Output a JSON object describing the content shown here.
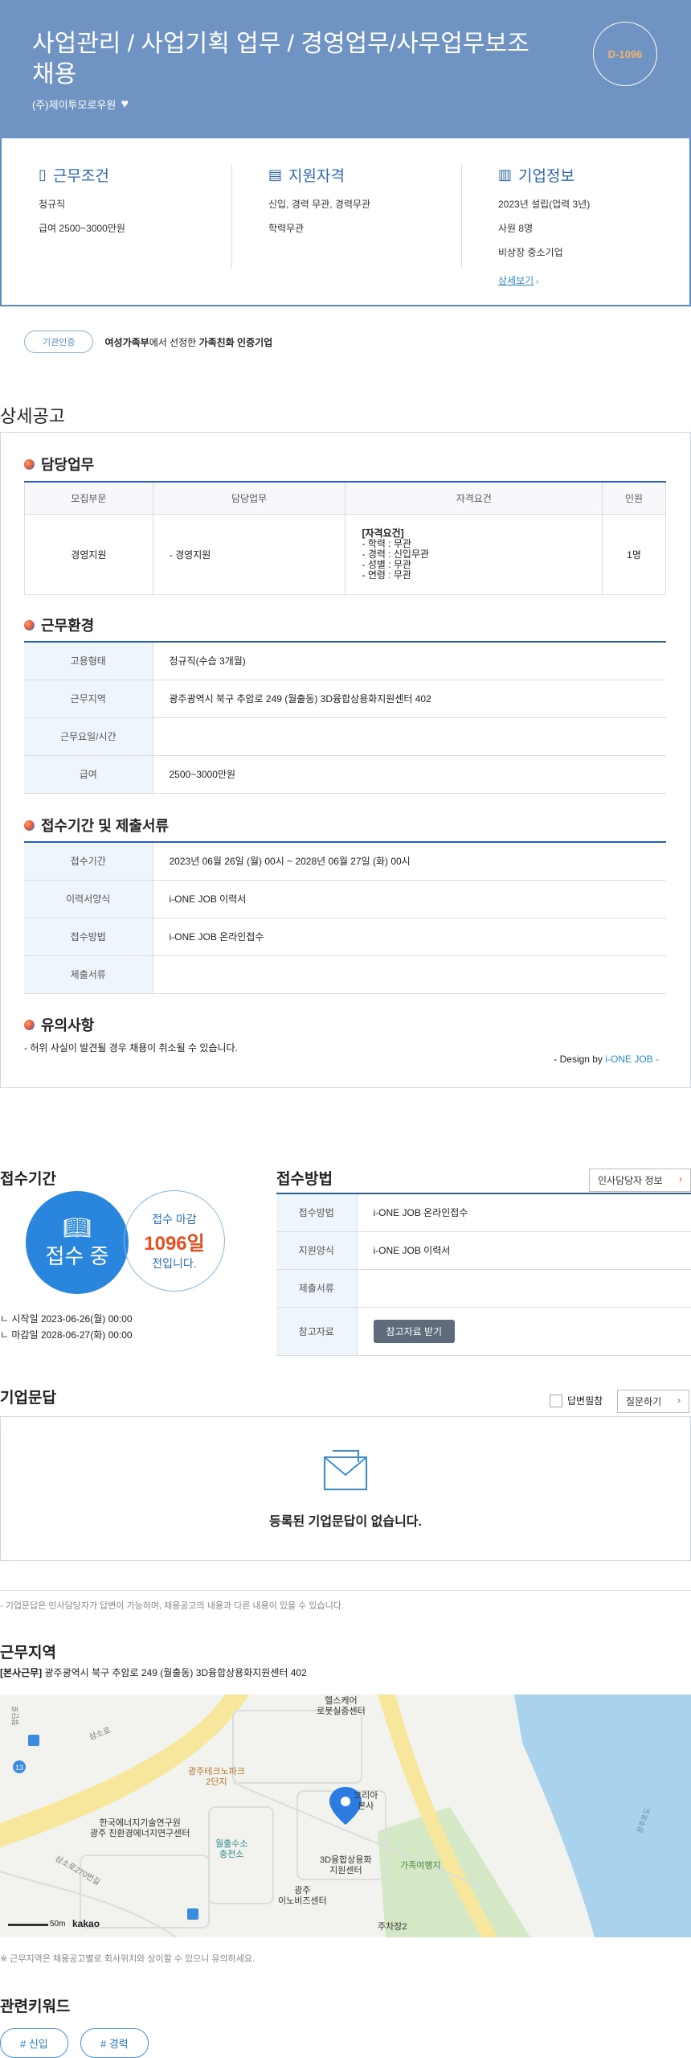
{
  "header": {
    "title": "사업관리 / 사업기획 업무 / 경영업무/사무업무보조 채용",
    "company": "(주)제이투모로우원",
    "dday": "D-1096"
  },
  "summary": {
    "work": {
      "title": "근무조건",
      "lines": [
        "정규직",
        "급여 2500~3000만원"
      ]
    },
    "qual": {
      "title": "지원자격",
      "lines": [
        "신입, 경력 무관, 경력무관",
        "학력무관"
      ]
    },
    "company": {
      "title": "기업정보",
      "lines": [
        "2023년 설립(업력 3년)",
        "사원 8명",
        "비상장 중소기업"
      ],
      "more": "상세보기"
    }
  },
  "cert": {
    "badge": "기관인증",
    "text_a": "여성가족부",
    "text_b": "에서 선정한 ",
    "text_c": "가족친화 인증기업"
  },
  "detail_title": "상세공고",
  "duty": {
    "title": "담당업무",
    "headers": [
      "모집부문",
      "담당업무",
      "자격요건",
      "인원"
    ],
    "row": {
      "dept": "경영지원",
      "task": "- 경영지원",
      "req_title": "[자격요건]",
      "req": [
        "- 학력 : 무관",
        "- 경력 : 신입무관",
        "- 성별 : 무관",
        "- 연령 : 무관"
      ],
      "count": "1명"
    }
  },
  "env": {
    "title": "근무환경",
    "rows": [
      {
        "k": "고용형태",
        "v": "정규직(수습 3개월)"
      },
      {
        "k": "근무지역",
        "v": "광주광역시 북구 추암로 249 (월출동) 3D융합상용화지원센터 402"
      },
      {
        "k": "근무요일/시간",
        "v": ""
      },
      {
        "k": "급여",
        "v": "2500~3000만원"
      }
    ]
  },
  "apply": {
    "title": "접수기간 및 제출서류",
    "rows": [
      {
        "k": "접수기간",
        "v": "2023년 06월 26일 (월) 00시 ~ 2028년 06월 27일 (화) 00시"
      },
      {
        "k": "이력서양식",
        "v": "i-ONE JOB 이력서"
      },
      {
        "k": "접수방법",
        "v": "i-ONE JOB 온라인접수"
      },
      {
        "k": "제출서류",
        "v": ""
      }
    ]
  },
  "caution": {
    "title": "유의사항",
    "text": "- 허위 사실이 발견될 경우 채용이 취소될 수 있습니다.",
    "design": "- Design by ",
    "design_brand": "i-ONE JOB",
    "design_end": " -"
  },
  "period": {
    "title": "접수기간",
    "status": "접수 중",
    "deadline_a": "접수 마감",
    "days": "1096일",
    "deadline_b": "전입니다.",
    "start": "시작일 2023-06-26(월) 00:00",
    "end": "마감일 2028-06-27(화) 00:00"
  },
  "method": {
    "title": "접수방법",
    "contact": "인사담당자 정보",
    "rows": [
      {
        "k": "접수방법",
        "v": "i-ONE JOB 온라인접수"
      },
      {
        "k": "지원양식",
        "v": "i-ONE JOB 이력서"
      },
      {
        "k": "제출서류",
        "v": ""
      },
      {
        "k": "참고자료",
        "v": ""
      }
    ],
    "download": "참고자료 받기"
  },
  "qa": {
    "title": "기업문답",
    "check": "답변필참",
    "ask": "질문하기",
    "empty": "등록된 기업문답이 없습니다.",
    "note": "- 기업문답은 인사담당자가 답변이 가능하며, 채용공고의 내용과 다른 내용이 있을 수 있습니다."
  },
  "location": {
    "title": "근무지역",
    "tag": "[본사근무]",
    "addr": " 광주광역시 북구 추암로 249 (월출동) 3D융합상용화지원센터 402",
    "note": "※ 근무지역은 채용공고별로 회사위치와 상이할 수 있으니 유의하세요."
  },
  "map": {
    "labels": {
      "l1": "헬스케어",
      "l2": "로봇실증센터",
      "l3": "광주테크노파크",
      "l4": "2단지",
      "l5": "코리아",
      "l6": "본사",
      "l7": "한국에너지기술연구원",
      "l8": "광주 친환경에너지연구센터",
      "l9": "월출수소",
      "l10": "충전소",
      "l11": "3D융합상용화",
      "l12": "지원센터",
      "l13": "광주",
      "l14": "이노비즈센터",
      "l15": "가족여행지",
      "l16": "주차장2",
      "l17": "첨단로",
      "l18": "삼소로",
      "l19": "삼소로270번길",
      "l20": "광주포도"
    },
    "scale": "50m",
    "brand": "kakao",
    "route": "13"
  },
  "keywords": {
    "title": "관련키워드",
    "items": [
      "# 신입",
      "# 경력"
    ]
  }
}
